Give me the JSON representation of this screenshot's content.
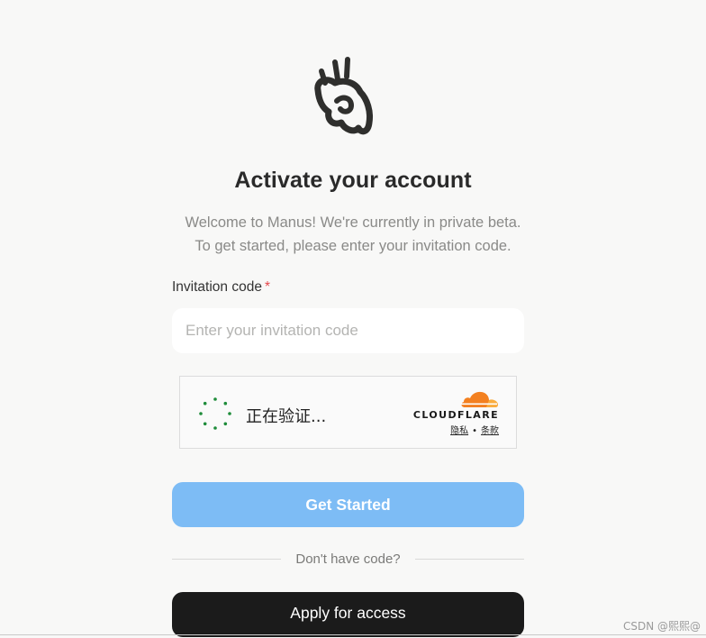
{
  "app": {
    "logo_icon": "manus-hand-logo-icon"
  },
  "header": {
    "title": "Activate your account",
    "subtitle_line1": "Welcome to Manus! We're currently in private beta.",
    "subtitle_line2": "To get started, please enter your invitation code."
  },
  "form": {
    "invite_label": "Invitation code",
    "required_mark": "*",
    "invite_placeholder": "Enter your invitation code",
    "invite_value": ""
  },
  "captcha": {
    "status_text": "正在验证...",
    "brand": "CLOUDFLARE",
    "privacy_link": "隐私",
    "separator": "•",
    "terms_link": "条款",
    "spinner_icon": "loading-spinner-icon",
    "colors": {
      "spinner": "#1e8c3a",
      "cloud_orange": "#f38020",
      "cloud_light": "#faad3f"
    }
  },
  "actions": {
    "start_label": "Get Started",
    "divider_text": "Don't have code?",
    "apply_label": "Apply for access"
  },
  "watermark": "CSDN @熙熙@",
  "colors": {
    "background": "#f8f8f7",
    "primary_button": "#7dbcf5",
    "apply_button": "#1b1b1b",
    "required": "#e5484d"
  }
}
